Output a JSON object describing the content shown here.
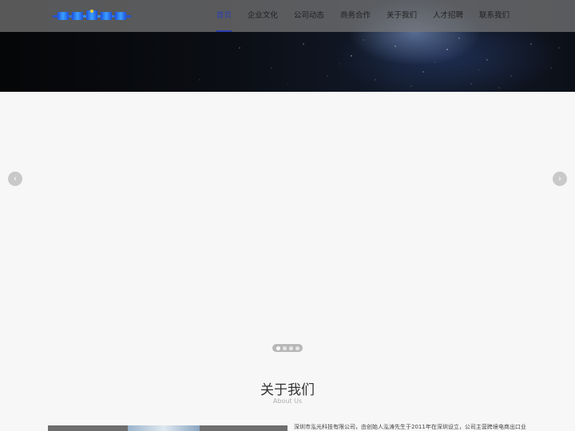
{
  "nav": {
    "items": [
      {
        "label": "首页",
        "active": true
      },
      {
        "label": "企业文化",
        "active": false
      },
      {
        "label": "公司动态",
        "active": false
      },
      {
        "label": "商务合作",
        "active": false
      },
      {
        "label": "关于我们",
        "active": false
      },
      {
        "label": "人才招聘",
        "active": false
      },
      {
        "label": "联系我们",
        "active": false
      }
    ]
  },
  "slider": {
    "prev_icon": "chevron-left-icon",
    "next_icon": "chevron-right-icon",
    "prev_glyph": "‹",
    "next_glyph": "›",
    "slide_count": 4,
    "active_slide": 1
  },
  "about": {
    "title": "关于我们",
    "subtitle": "About Us",
    "text": "深圳市泓光科技有限公司，由创始人泓涛先生于2011年在深圳设立，公司主营跨境电商出口业"
  },
  "colors": {
    "accent": "#2a3fb0",
    "nav_bg": "#787878"
  }
}
